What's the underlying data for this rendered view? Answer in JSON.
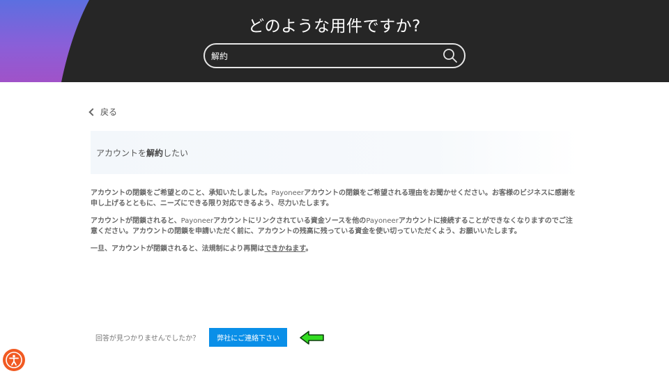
{
  "header": {
    "title": "どのような用件ですか?",
    "search": {
      "value": "解約",
      "placeholder": ""
    }
  },
  "nav": {
    "back_label": "戻る"
  },
  "question": {
    "prefix": "アカウントを",
    "keyword": "解約",
    "suffix": "したい"
  },
  "article": {
    "p1": {
      "a": "アカウントの閉鎖をご希望とのこと、承知いたしました。",
      "brand": "Payoneer",
      "b": "アカウントの閉鎖をご希望される理由をお聞かせください。お客様のビジネスに感謝を申し上げるとともに、ニーズにできる限り対応できるよう、尽力いたします。"
    },
    "p2": {
      "a": "アカウントが閉鎖されると、",
      "brand1": "Payoneer",
      "b": "アカウントにリンクされている資金ソースを他の",
      "brand2": "Payoneer",
      "c": "アカウントに接続することができなくなりますのでご注意ください。アカウントの閉鎖を申請いただく前に、アカウントの残高に残っている資金を使い切っていただくよう、お願いいたします。"
    },
    "p3": {
      "a": "一旦、アカウントが閉鎖されると、法規制により再開は",
      "link": "できかねます",
      "b": "。"
    }
  },
  "footer": {
    "prompt": "回答が見つかりませんでしたか？",
    "contact_label": "弊社にご連絡下さい"
  },
  "colors": {
    "header_bg": "#262626",
    "contact_button": "#0a8fe8",
    "accessibility_button": "#f15a22",
    "annotation_arrow": "#33dd22"
  },
  "icons": {
    "search": "search-icon",
    "back": "chevron-left-icon",
    "accessibility": "accessibility-icon",
    "annotation": "arrow-left-icon"
  }
}
